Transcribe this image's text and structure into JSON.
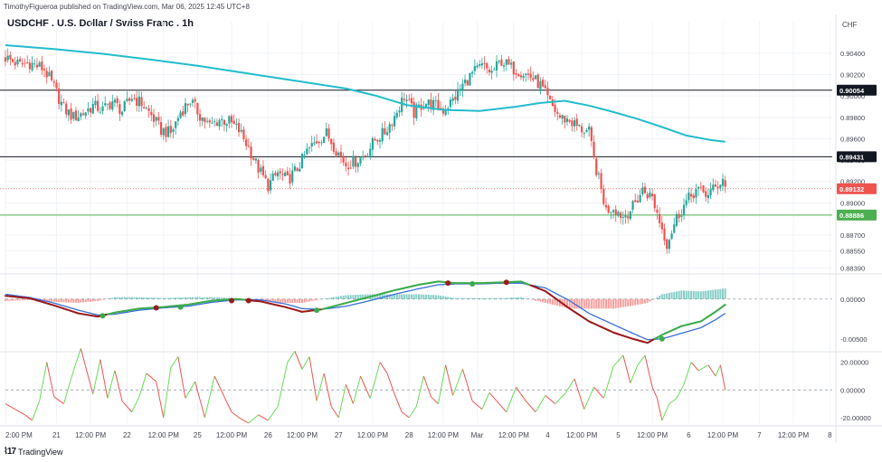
{
  "header": {
    "published_note": "TimothyFigueroa published on TradingView.com, Mar 06, 2025 12:45 UTC+8",
    "symbol_title": "USDCHF . U.S. Dollar / Swiss Franc . 1h",
    "currency": "CHF"
  },
  "footer": {
    "brand": "TradingView",
    "brand_logo": "TV-logo-icon"
  },
  "colors": {
    "up": "#26a69a",
    "down": "#ef5350",
    "ma": "#22bccc",
    "macd_fast": "#3cab4b",
    "macd_slow": "#3a6fd8",
    "macd_dark": "#9b1c1c",
    "osc_up": "#66dd55",
    "osc_down": "#ef5350",
    "grid": "#f0f3fa"
  },
  "chart_data": [
    {
      "type": "candlestick",
      "panel": "price",
      "y_axis_ticks": [
        "0.90400",
        "0.90200",
        "0.90000",
        "0.89800",
        "0.89600",
        "0.89400",
        "0.89200",
        "0.89000",
        "0.88700",
        "0.88550",
        "0.88390"
      ],
      "ylim": [
        0.8836,
        0.9056
      ],
      "horizontal_lines": [
        {
          "value": 0.90054,
          "label": "0.90054",
          "color": "#131722"
        },
        {
          "value": 0.89431,
          "label": "0.89431",
          "color": "#131722"
        },
        {
          "value": 0.89132,
          "label": "0.89132",
          "color": "#ef5350",
          "dotted": true
        },
        {
          "value": 0.88886,
          "label": "0.88886",
          "color": "#4caf50"
        }
      ],
      "close_path": [
        [
          0,
          0.9036
        ],
        [
          6,
          0.9029
        ],
        [
          10,
          0.9031
        ],
        [
          16,
          0.9025
        ],
        [
          20,
          0.9008
        ],
        [
          24,
          0.8988
        ],
        [
          28,
          0.898
        ],
        [
          32,
          0.8984
        ],
        [
          36,
          0.8991
        ],
        [
          40,
          0.8987
        ],
        [
          44,
          0.8995
        ],
        [
          48,
          0.8986
        ],
        [
          52,
          0.8999
        ],
        [
          56,
          0.8993
        ],
        [
          60,
          0.8982
        ],
        [
          64,
          0.8968
        ],
        [
          68,
          0.8965
        ],
        [
          72,
          0.8985
        ],
        [
          76,
          0.8996
        ],
        [
          80,
          0.8982
        ],
        [
          84,
          0.8972
        ],
        [
          88,
          0.8978
        ],
        [
          92,
          0.8976
        ],
        [
          96,
          0.8968
        ],
        [
          100,
          0.8952
        ],
        [
          104,
          0.8932
        ],
        [
          108,
          0.8916
        ],
        [
          112,
          0.8928
        ],
        [
          116,
          0.8921
        ],
        [
          120,
          0.8932
        ],
        [
          124,
          0.8948
        ],
        [
          128,
          0.8958
        ],
        [
          132,
          0.8965
        ],
        [
          136,
          0.895
        ],
        [
          140,
          0.8936
        ],
        [
          144,
          0.8939
        ],
        [
          148,
          0.8945
        ],
        [
          152,
          0.8959
        ],
        [
          156,
          0.8966
        ],
        [
          160,
          0.8981
        ],
        [
          164,
          0.9
        ],
        [
          168,
          0.8984
        ],
        [
          172,
          0.8994
        ],
        [
          176,
          0.8992
        ],
        [
          180,
          0.8987
        ],
        [
          184,
          0.8996
        ],
        [
          188,
          0.901
        ],
        [
          192,
          0.9021
        ],
        [
          196,
          0.9028
        ],
        [
          200,
          0.9022
        ],
        [
          204,
          0.9033
        ],
        [
          208,
          0.9026
        ],
        [
          212,
          0.9023
        ],
        [
          216,
          0.9018
        ],
        [
          220,
          0.901
        ],
        [
          224,
          0.8993
        ],
        [
          228,
          0.898
        ],
        [
          232,
          0.8977
        ],
        [
          236,
          0.897
        ],
        [
          240,
          0.8966
        ],
        [
          242,
          0.894
        ],
        [
          244,
          0.8922
        ],
        [
          247,
          0.8893
        ],
        [
          250,
          0.8896
        ],
        [
          254,
          0.8887
        ],
        [
          258,
          0.8896
        ],
        [
          262,
          0.8912
        ],
        [
          266,
          0.8905
        ],
        [
          270,
          0.8876
        ],
        [
          272,
          0.8862
        ],
        [
          276,
          0.8886
        ],
        [
          280,
          0.8901
        ],
        [
          284,
          0.8912
        ],
        [
          288,
          0.8908
        ],
        [
          292,
          0.8914
        ],
        [
          295,
          0.8923
        ],
        [
          296,
          0.8915
        ]
      ],
      "series": [
        {
          "name": "",
          "type": "moving-average",
          "values": [
            [
              0,
              0.90475
            ],
            [
              20,
              0.9044
            ],
            [
              40,
              0.90395
            ],
            [
              60,
              0.9034
            ],
            [
              80,
              0.9028
            ],
            [
              100,
              0.9021
            ],
            [
              120,
              0.9014
            ],
            [
              140,
              0.9007
            ],
            [
              152,
              0.90005
            ],
            [
              165,
              0.89915
            ],
            [
              180,
              0.8987
            ],
            [
              195,
              0.8986
            ],
            [
              210,
              0.899
            ],
            [
              220,
              0.89935
            ],
            [
              230,
              0.89955
            ],
            [
              240,
              0.8991
            ],
            [
              250,
              0.8985
            ],
            [
              260,
              0.89785
            ],
            [
              270,
              0.8971
            ],
            [
              280,
              0.8963
            ],
            [
              290,
              0.89588
            ],
            [
              296,
              0.89572
            ]
          ]
        }
      ]
    },
    {
      "type": "line",
      "panel": "macd",
      "y_axis_ticks": [
        "0.00000",
        "-0.00500"
      ],
      "ylim": [
        -0.0065,
        0.0027
      ],
      "series": [
        {
          "name": "",
          "values": [
            [
              0,
              0.0004
            ],
            [
              10,
              0.0001
            ],
            [
              20,
              -0.0008
            ],
            [
              30,
              -0.0018
            ],
            [
              38,
              -0.0022
            ],
            [
              45,
              -0.0017
            ],
            [
              55,
              -0.0012
            ],
            [
              65,
              -0.001
            ],
            [
              75,
              -0.0007
            ],
            [
              85,
              -0.0002
            ],
            [
              95,
              0.0
            ],
            [
              105,
              -0.0003
            ],
            [
              115,
              -0.001
            ],
            [
              122,
              -0.0016
            ],
            [
              130,
              -0.0013
            ],
            [
              140,
              -0.0005
            ],
            [
              150,
              0.0003
            ],
            [
              160,
              0.0011
            ],
            [
              170,
              0.0018
            ],
            [
              178,
              0.0022
            ],
            [
              185,
              0.002
            ],
            [
              195,
              0.002
            ],
            [
              205,
              0.0021
            ],
            [
              212,
              0.0022
            ],
            [
              222,
              0.001
            ],
            [
              232,
              -0.0012
            ],
            [
              240,
              -0.0028
            ],
            [
              250,
              -0.0042
            ],
            [
              258,
              -0.005
            ],
            [
              264,
              -0.0055
            ],
            [
              270,
              -0.0045
            ],
            [
              278,
              -0.0034
            ],
            [
              286,
              -0.0028
            ],
            [
              292,
              -0.0016
            ],
            [
              296,
              -0.0007
            ]
          ]
        },
        {
          "name": "",
          "values": [
            [
              0,
              0.0006
            ],
            [
              10,
              0.0002
            ],
            [
              20,
              -0.0005
            ],
            [
              30,
              -0.0014
            ],
            [
              38,
              -0.002
            ],
            [
              45,
              -0.0019
            ],
            [
              55,
              -0.0014
            ],
            [
              65,
              -0.0011
            ],
            [
              75,
              -0.0009
            ],
            [
              85,
              -0.0004
            ],
            [
              95,
              -0.0001
            ],
            [
              105,
              -0.0001
            ],
            [
              115,
              -0.0006
            ],
            [
              122,
              -0.0012
            ],
            [
              130,
              -0.0013
            ],
            [
              140,
              -0.0009
            ],
            [
              150,
              -0.0002
            ],
            [
              160,
              0.0006
            ],
            [
              170,
              0.0013
            ],
            [
              178,
              0.0018
            ],
            [
              185,
              0.0019
            ],
            [
              195,
              0.0019
            ],
            [
              205,
              0.002
            ],
            [
              212,
              0.002
            ],
            [
              222,
              0.0014
            ],
            [
              232,
              -0.0002
            ],
            [
              240,
              -0.0018
            ],
            [
              250,
              -0.0032
            ],
            [
              258,
              -0.0043
            ],
            [
              264,
              -0.0051
            ],
            [
              270,
              -0.005
            ],
            [
              278,
              -0.0043
            ],
            [
              286,
              -0.0036
            ],
            [
              292,
              -0.0026
            ],
            [
              296,
              -0.0018
            ]
          ]
        }
      ],
      "cross_markers": [
        [
          40,
          -0.0021,
          "green"
        ],
        [
          62,
          -0.0011,
          "darkred"
        ],
        [
          72,
          -0.001,
          "green"
        ],
        [
          93,
          -0.0002,
          "darkred"
        ],
        [
          100,
          -0.0002,
          "darkred"
        ],
        [
          128,
          -0.0014,
          "green"
        ],
        [
          182,
          0.002,
          "darkred"
        ],
        [
          192,
          0.0019,
          "green"
        ],
        [
          206,
          0.0021,
          "darkred"
        ],
        [
          270,
          -0.005,
          "green"
        ]
      ],
      "histogram_range": [
        0,
        296
      ]
    },
    {
      "type": "line",
      "panel": "oscillator",
      "y_axis_ticks": [
        "20.00000",
        "0.00000",
        "-20.00000"
      ],
      "ylim": [
        -24,
        27
      ],
      "values": [
        [
          0,
          -10
        ],
        [
          4,
          -14
        ],
        [
          8,
          -18
        ],
        [
          11,
          -22
        ],
        [
          14,
          -8
        ],
        [
          17,
          20
        ],
        [
          20,
          -5
        ],
        [
          24,
          -10
        ],
        [
          28,
          14
        ],
        [
          31,
          30
        ],
        [
          34,
          10
        ],
        [
          36,
          -3
        ],
        [
          39,
          22
        ],
        [
          42,
          -6
        ],
        [
          45,
          14
        ],
        [
          48,
          -8
        ],
        [
          52,
          -16
        ],
        [
          55,
          -5
        ],
        [
          58,
          12
        ],
        [
          62,
          6
        ],
        [
          65,
          -20
        ],
        [
          68,
          16
        ],
        [
          71,
          24
        ],
        [
          74,
          -6
        ],
        [
          78,
          6
        ],
        [
          82,
          -20
        ],
        [
          86,
          10
        ],
        [
          90,
          -5
        ],
        [
          93,
          -16
        ],
        [
          96,
          -20
        ],
        [
          100,
          -24
        ],
        [
          104,
          -18
        ],
        [
          108,
          -22
        ],
        [
          112,
          -12
        ],
        [
          116,
          20
        ],
        [
          119,
          28
        ],
        [
          122,
          15
        ],
        [
          125,
          24
        ],
        [
          128,
          -8
        ],
        [
          131,
          12
        ],
        [
          134,
          -12
        ],
        [
          137,
          -20
        ],
        [
          140,
          4
        ],
        [
          143,
          -10
        ],
        [
          146,
          10
        ],
        [
          150,
          -6
        ],
        [
          154,
          20
        ],
        [
          157,
          12
        ],
        [
          160,
          -3
        ],
        [
          163,
          -16
        ],
        [
          166,
          -20
        ],
        [
          169,
          -12
        ],
        [
          172,
          10
        ],
        [
          175,
          -5
        ],
        [
          178,
          -10
        ],
        [
          181,
          18
        ],
        [
          184,
          -4
        ],
        [
          188,
          15
        ],
        [
          192,
          -8
        ],
        [
          196,
          -14
        ],
        [
          199,
          -2
        ],
        [
          203,
          -10
        ],
        [
          206,
          -16
        ],
        [
          210,
          2
        ],
        [
          214,
          -8
        ],
        [
          218,
          -16
        ],
        [
          222,
          -4
        ],
        [
          226,
          -10
        ],
        [
          230,
          -3
        ],
        [
          234,
          8
        ],
        [
          238,
          -14
        ],
        [
          242,
          2
        ],
        [
          246,
          -6
        ],
        [
          250,
          17
        ],
        [
          254,
          25
        ],
        [
          257,
          5
        ],
        [
          260,
          18
        ],
        [
          263,
          25
        ],
        [
          266,
          2
        ],
        [
          268,
          -6
        ],
        [
          270,
          -22
        ],
        [
          273,
          -10
        ],
        [
          276,
          -6
        ],
        [
          279,
          4
        ],
        [
          282,
          20
        ],
        [
          285,
          14
        ],
        [
          289,
          18
        ],
        [
          292,
          10
        ],
        [
          294,
          18
        ],
        [
          296,
          0
        ]
      ]
    }
  ],
  "x_axis": {
    "domain": [
      0,
      340
    ],
    "ticks": [
      {
        "label": "2:00 PM",
        "x": 0
      },
      {
        "label": "21",
        "x": 21
      },
      {
        "label": "12:00 PM",
        "x": 35
      },
      {
        "label": "22",
        "x": 50
      },
      {
        "label": "12:00 PM",
        "x": 65
      },
      {
        "label": "25",
        "x": 79
      },
      {
        "label": "12:00 PM",
        "x": 93
      },
      {
        "label": "26",
        "x": 108
      },
      {
        "label": "12:00 PM",
        "x": 122
      },
      {
        "label": "27",
        "x": 137
      },
      {
        "label": "12:00 PM",
        "x": 151
      },
      {
        "label": "28",
        "x": 166
      },
      {
        "label": "12:00 PM",
        "x": 180
      },
      {
        "label": "Mar",
        "x": 194
      },
      {
        "label": "12:00 PM",
        "x": 209
      },
      {
        "label": "4",
        "x": 223
      },
      {
        "label": "12:00 PM",
        "x": 237
      },
      {
        "label": "5",
        "x": 252
      },
      {
        "label": "12:00 PM",
        "x": 266
      },
      {
        "label": "6",
        "x": 281
      },
      {
        "label": "12:00 PM",
        "x": 295
      },
      {
        "label": "7",
        "x": 310
      },
      {
        "label": "12:00 PM",
        "x": 324
      },
      {
        "label": "8",
        "x": 339
      }
    ]
  }
}
